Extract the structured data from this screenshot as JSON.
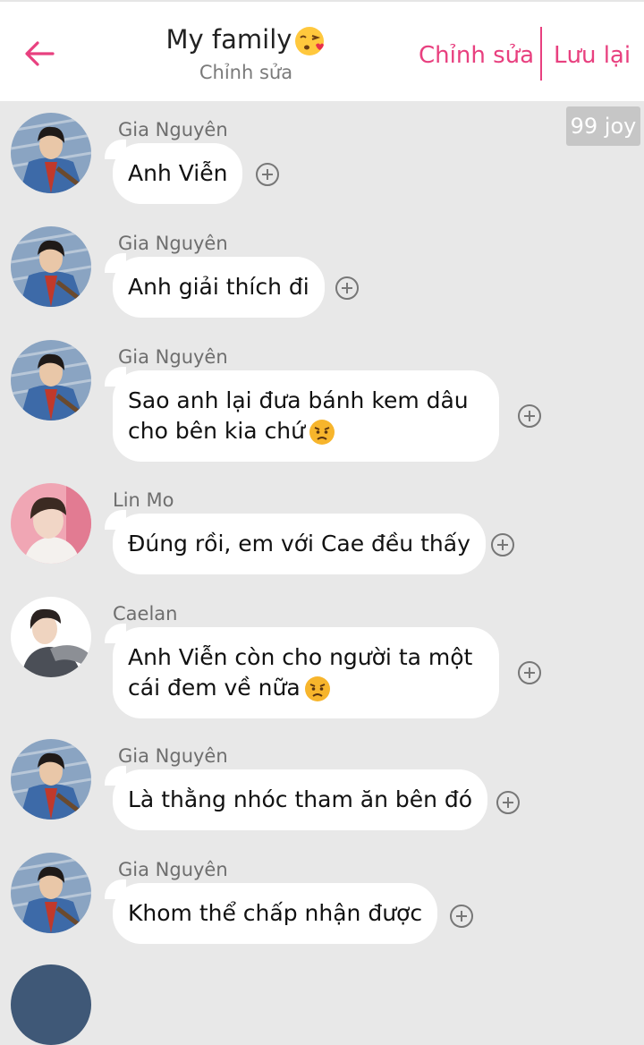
{
  "header": {
    "back_icon": "arrow-left-icon",
    "title": "My family",
    "title_emoji": "winking-kiss-emoji",
    "subtitle": "Chỉnh sửa",
    "edit_label": "Chỉnh sửa",
    "save_label": "Lưu lại",
    "accent_color": "#e8407f"
  },
  "badge": {
    "label": "99 joy"
  },
  "messages": [
    {
      "sender": "Gia Nguyên",
      "text": "Anh Viễn",
      "emoji": ""
    },
    {
      "sender": "Gia Nguyên",
      "text": "Anh giải thích đi",
      "emoji": ""
    },
    {
      "sender": "Gia Nguyên",
      "text": "Sao anh lại đưa bánh kem dâu\ncho bên kia chứ",
      "emoji": "angry-face-emoji"
    },
    {
      "sender": "Lin Mo",
      "text": "Đúng rồi, em với Cae đều thấy",
      "emoji": ""
    },
    {
      "sender": "Caelan",
      "text": "Anh Viễn còn cho người ta một\ncái đem về nữa",
      "emoji": "angry-face-emoji"
    },
    {
      "sender": "Gia Nguyên",
      "text": "Là thằng nhóc tham ăn bên đó",
      "emoji": ""
    },
    {
      "sender": "Gia Nguyên",
      "text": "Khom thể chấp nhận được",
      "emoji": ""
    }
  ]
}
